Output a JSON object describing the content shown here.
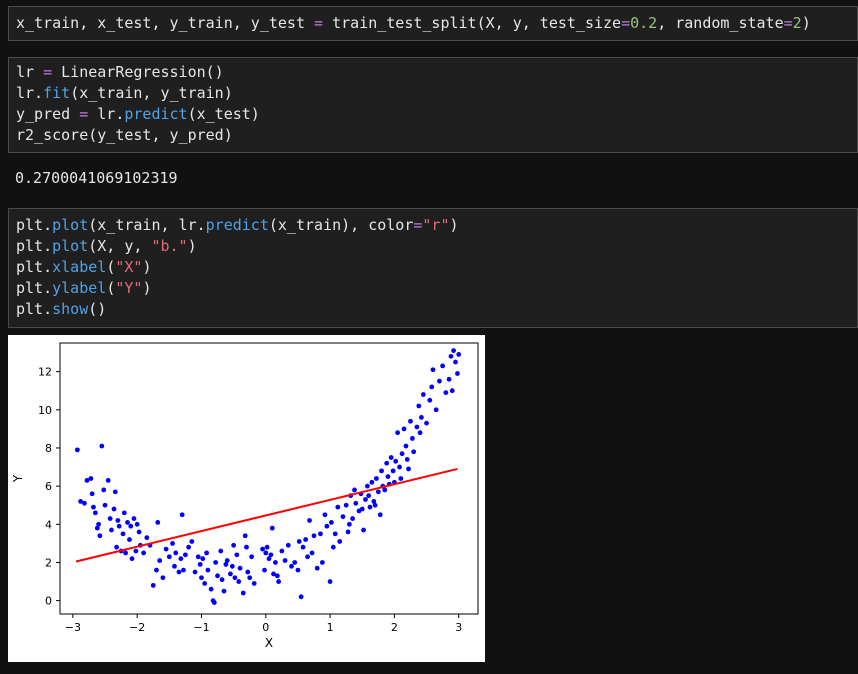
{
  "cells": [
    {
      "lines": [
        [
          {
            "t": "x_train, x_test, y_train, y_test ",
            "c": ""
          },
          {
            "t": "=",
            "c": "op"
          },
          {
            "t": " train_test_split(X, y, test_size",
            "c": ""
          },
          {
            "t": "=",
            "c": "op"
          },
          {
            "t": "0.2",
            "c": "num"
          },
          {
            "t": ", random_state",
            "c": ""
          },
          {
            "t": "=",
            "c": "op"
          },
          {
            "t": "2",
            "c": "num"
          },
          {
            "t": ")",
            "c": ""
          }
        ]
      ]
    },
    {
      "lines": [
        [
          {
            "t": "lr ",
            "c": ""
          },
          {
            "t": "=",
            "c": "op"
          },
          {
            "t": " LinearRegression()",
            "c": ""
          }
        ],
        [
          {
            "t": "lr.",
            "c": ""
          },
          {
            "t": "fit",
            "c": "fn"
          },
          {
            "t": "(x_train, y_train)",
            "c": ""
          }
        ],
        [
          {
            "t": "y_pred ",
            "c": ""
          },
          {
            "t": "=",
            "c": "op"
          },
          {
            "t": " lr.",
            "c": ""
          },
          {
            "t": "predict",
            "c": "fn"
          },
          {
            "t": "(x_test)",
            "c": ""
          }
        ],
        [
          {
            "t": "r2_score(y_test, y_pred)",
            "c": ""
          }
        ]
      ]
    },
    {
      "lines": [
        [
          {
            "t": "plt.",
            "c": ""
          },
          {
            "t": "plot",
            "c": "fn"
          },
          {
            "t": "(x_train, lr.",
            "c": ""
          },
          {
            "t": "predict",
            "c": "fn"
          },
          {
            "t": "(x_train), color",
            "c": ""
          },
          {
            "t": "=",
            "c": "op"
          },
          {
            "t": "\"r\"",
            "c": "str"
          },
          {
            "t": ")",
            "c": ""
          }
        ],
        [
          {
            "t": "plt.",
            "c": ""
          },
          {
            "t": "plot",
            "c": "fn"
          },
          {
            "t": "(X, y, ",
            "c": ""
          },
          {
            "t": "\"b.\"",
            "c": "str"
          },
          {
            "t": ")",
            "c": ""
          }
        ],
        [
          {
            "t": "plt.",
            "c": ""
          },
          {
            "t": "xlabel",
            "c": "fn"
          },
          {
            "t": "(",
            "c": ""
          },
          {
            "t": "\"X\"",
            "c": "str"
          },
          {
            "t": ")",
            "c": ""
          }
        ],
        [
          {
            "t": "plt.",
            "c": ""
          },
          {
            "t": "ylabel",
            "c": "fn"
          },
          {
            "t": "(",
            "c": ""
          },
          {
            "t": "\"Y\"",
            "c": "str"
          },
          {
            "t": ")",
            "c": ""
          }
        ],
        [
          {
            "t": "plt.",
            "c": ""
          },
          {
            "t": "show",
            "c": "fn"
          },
          {
            "t": "()",
            "c": ""
          }
        ]
      ]
    }
  ],
  "output": {
    "r2_value": "0.2700041069102319"
  },
  "colors": {
    "points": "#0000ff",
    "line": "#ff0000",
    "fn": "#4fa3e8",
    "op": "#c678dd",
    "num": "#98c379",
    "str": "#e06c75"
  },
  "chart_data": {
    "type": "scatter",
    "xlabel": "X",
    "ylabel": "Y",
    "xlim": [
      -3.2,
      3.3
    ],
    "ylim": [
      -0.7,
      13.5
    ],
    "xticks": [
      -3,
      -2,
      -1,
      0,
      1,
      2,
      3
    ],
    "yticks": [
      0,
      2,
      4,
      6,
      8,
      10,
      12
    ],
    "grid": false,
    "series": [
      {
        "kind": "scatter",
        "color": "#0000ff",
        "points": [
          [
            -2.93,
            7.9
          ],
          [
            -2.88,
            5.2
          ],
          [
            -2.82,
            5.1
          ],
          [
            -2.78,
            6.3
          ],
          [
            -2.72,
            6.4
          ],
          [
            -2.7,
            5.6
          ],
          [
            -2.68,
            4.9
          ],
          [
            -2.65,
            4.6
          ],
          [
            -2.62,
            3.8
          ],
          [
            -2.6,
            4.0
          ],
          [
            -2.58,
            3.4
          ],
          [
            -2.55,
            8.1
          ],
          [
            -2.52,
            5.8
          ],
          [
            -2.5,
            5.0
          ],
          [
            -2.45,
            6.3
          ],
          [
            -2.42,
            4.3
          ],
          [
            -2.4,
            3.7
          ],
          [
            -2.36,
            4.8
          ],
          [
            -2.34,
            5.7
          ],
          [
            -2.32,
            2.8
          ],
          [
            -2.3,
            4.2
          ],
          [
            -2.28,
            3.9
          ],
          [
            -2.25,
            2.6
          ],
          [
            -2.22,
            3.5
          ],
          [
            -2.2,
            4.6
          ],
          [
            -2.18,
            2.5
          ],
          [
            -2.15,
            4.1
          ],
          [
            -2.12,
            3.2
          ],
          [
            -2.1,
            3.9
          ],
          [
            -2.08,
            2.2
          ],
          [
            -2.05,
            4.3
          ],
          [
            -2.02,
            2.6
          ],
          [
            -2.0,
            4.0
          ],
          [
            -1.97,
            3.6
          ],
          [
            -1.95,
            2.9
          ],
          [
            -1.9,
            2.5
          ],
          [
            -1.85,
            3.3
          ],
          [
            -1.8,
            2.9
          ],
          [
            -1.75,
            0.8
          ],
          [
            -1.7,
            1.6
          ],
          [
            -1.68,
            4.1
          ],
          [
            -1.65,
            2.1
          ],
          [
            -1.6,
            1.2
          ],
          [
            -1.55,
            2.7
          ],
          [
            -1.5,
            2.3
          ],
          [
            -1.45,
            3.0
          ],
          [
            -1.42,
            1.8
          ],
          [
            -1.4,
            2.5
          ],
          [
            -1.35,
            1.5
          ],
          [
            -1.32,
            2.2
          ],
          [
            -1.3,
            4.5
          ],
          [
            -1.28,
            1.6
          ],
          [
            -1.25,
            2.4
          ],
          [
            -1.2,
            2.8
          ],
          [
            -1.15,
            3.1
          ],
          [
            -1.1,
            1.5
          ],
          [
            -1.05,
            2.3
          ],
          [
            -1.02,
            1.9
          ],
          [
            -1.0,
            1.2
          ],
          [
            -0.98,
            2.2
          ],
          [
            -0.95,
            0.9
          ],
          [
            -0.92,
            2.5
          ],
          [
            -0.9,
            1.6
          ],
          [
            -0.85,
            0.6
          ],
          [
            -0.82,
            0.0
          ],
          [
            -0.8,
            -0.1
          ],
          [
            -0.78,
            2.0
          ],
          [
            -0.75,
            1.3
          ],
          [
            -0.7,
            2.6
          ],
          [
            -0.68,
            1.1
          ],
          [
            -0.65,
            0.5
          ],
          [
            -0.62,
            1.9
          ],
          [
            -0.6,
            2.1
          ],
          [
            -0.55,
            1.4
          ],
          [
            -0.52,
            1.8
          ],
          [
            -0.5,
            2.9
          ],
          [
            -0.48,
            1.2
          ],
          [
            -0.45,
            2.4
          ],
          [
            -0.42,
            1.0
          ],
          [
            -0.4,
            1.7
          ],
          [
            -0.35,
            0.4
          ],
          [
            -0.32,
            3.4
          ],
          [
            -0.3,
            2.8
          ],
          [
            -0.28,
            1.5
          ],
          [
            -0.25,
            1.2
          ],
          [
            -0.22,
            2.3
          ],
          [
            -0.18,
            0.9
          ],
          [
            -0.05,
            2.7
          ],
          [
            -0.02,
            1.6
          ],
          [
            0.0,
            2.5
          ],
          [
            0.02,
            2.8
          ],
          [
            0.05,
            2.2
          ],
          [
            0.08,
            2.4
          ],
          [
            0.1,
            3.8
          ],
          [
            0.12,
            1.4
          ],
          [
            0.15,
            2.0
          ],
          [
            0.18,
            1.3
          ],
          [
            0.2,
            1.0
          ],
          [
            0.25,
            2.6
          ],
          [
            0.3,
            2.1
          ],
          [
            0.35,
            2.9
          ],
          [
            0.4,
            1.8
          ],
          [
            0.45,
            2.0
          ],
          [
            0.5,
            1.6
          ],
          [
            0.52,
            3.1
          ],
          [
            0.55,
            0.2
          ],
          [
            0.58,
            2.8
          ],
          [
            0.62,
            3.2
          ],
          [
            0.65,
            2.3
          ],
          [
            0.68,
            4.2
          ],
          [
            0.72,
            2.5
          ],
          [
            0.75,
            3.4
          ],
          [
            0.8,
            1.7
          ],
          [
            0.85,
            3.5
          ],
          [
            0.88,
            2.0
          ],
          [
            0.92,
            4.5
          ],
          [
            0.95,
            3.9
          ],
          [
            1.0,
            1.0
          ],
          [
            1.02,
            4.1
          ],
          [
            1.05,
            2.8
          ],
          [
            1.08,
            3.5
          ],
          [
            1.12,
            4.9
          ],
          [
            1.15,
            3.1
          ],
          [
            1.2,
            4.4
          ],
          [
            1.25,
            5.0
          ],
          [
            1.28,
            3.6
          ],
          [
            1.3,
            4.0
          ],
          [
            1.32,
            5.5
          ],
          [
            1.35,
            4.3
          ],
          [
            1.38,
            5.8
          ],
          [
            1.4,
            5.1
          ],
          [
            1.45,
            4.7
          ],
          [
            1.48,
            5.6
          ],
          [
            1.5,
            4.8
          ],
          [
            1.52,
            3.7
          ],
          [
            1.55,
            5.3
          ],
          [
            1.58,
            6.0
          ],
          [
            1.6,
            5.5
          ],
          [
            1.62,
            4.9
          ],
          [
            1.65,
            6.2
          ],
          [
            1.68,
            5.2
          ],
          [
            1.7,
            5.0
          ],
          [
            1.72,
            6.4
          ],
          [
            1.75,
            5.7
          ],
          [
            1.78,
            4.5
          ],
          [
            1.8,
            6.8
          ],
          [
            1.82,
            6.0
          ],
          [
            1.85,
            5.8
          ],
          [
            1.88,
            7.2
          ],
          [
            1.9,
            6.5
          ],
          [
            1.92,
            6.1
          ],
          [
            1.95,
            7.5
          ],
          [
            1.98,
            6.8
          ],
          [
            2.0,
            6.2
          ],
          [
            2.02,
            7.3
          ],
          [
            2.05,
            8.8
          ],
          [
            2.08,
            7.0
          ],
          [
            2.1,
            6.4
          ],
          [
            2.12,
            7.7
          ],
          [
            2.15,
            9.0
          ],
          [
            2.18,
            8.1
          ],
          [
            2.2,
            7.4
          ],
          [
            2.22,
            6.9
          ],
          [
            2.25,
            9.4
          ],
          [
            2.28,
            8.5
          ],
          [
            2.3,
            7.8
          ],
          [
            2.35,
            9.1
          ],
          [
            2.38,
            10.2
          ],
          [
            2.4,
            8.8
          ],
          [
            2.42,
            9.6
          ],
          [
            2.45,
            10.8
          ],
          [
            2.5,
            9.3
          ],
          [
            2.55,
            10.5
          ],
          [
            2.58,
            11.2
          ],
          [
            2.6,
            12.1
          ],
          [
            2.65,
            10.0
          ],
          [
            2.7,
            11.5
          ],
          [
            2.75,
            12.3
          ],
          [
            2.8,
            10.9
          ],
          [
            2.85,
            11.6
          ],
          [
            2.88,
            12.8
          ],
          [
            2.92,
            13.1
          ],
          [
            2.95,
            12.5
          ],
          [
            2.98,
            11.9
          ],
          [
            3.0,
            12.9
          ],
          [
            2.9,
            11.0
          ]
        ]
      },
      {
        "kind": "line",
        "color": "#ff0000",
        "points": [
          [
            -2.95,
            2.05
          ],
          [
            2.98,
            6.9
          ]
        ]
      }
    ]
  }
}
